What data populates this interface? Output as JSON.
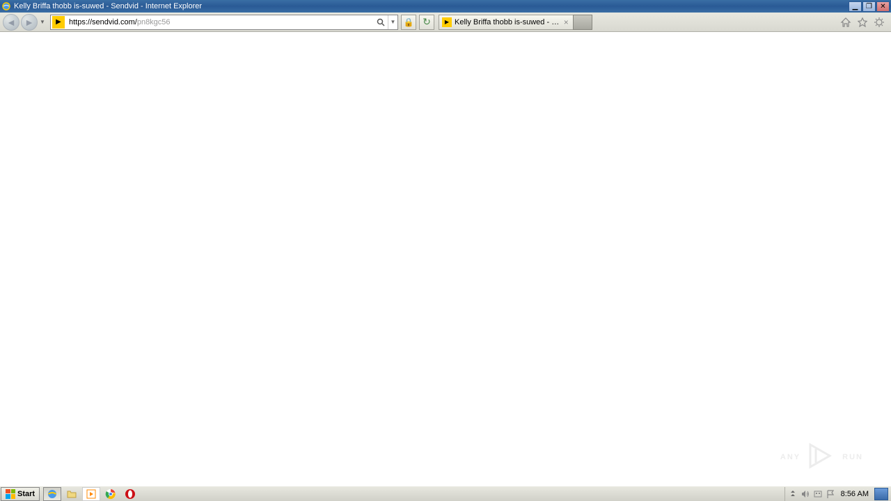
{
  "window": {
    "title": "Kelly Briffa thobb is-suwed - Sendvid - Internet Explorer"
  },
  "address": {
    "url_main": "https://sendvid.com/",
    "url_path": "pn8kgc56"
  },
  "tab": {
    "label": "Kelly Briffa thobb is-suwed - …"
  },
  "watermark": {
    "left": "ANY",
    "right": "RUN"
  },
  "taskbar": {
    "start": "Start",
    "clock": "8:56 AM"
  }
}
